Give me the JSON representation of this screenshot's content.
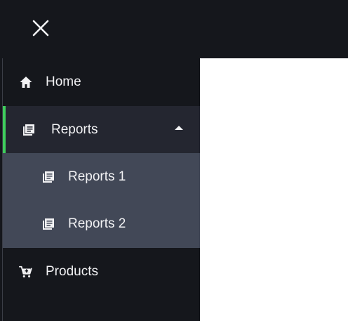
{
  "header": {
    "close_icon": "close-icon"
  },
  "sidebar": {
    "items": [
      {
        "label": "Home",
        "icon": "home-icon"
      },
      {
        "label": "Reports",
        "icon": "reports-icon",
        "expanded": true,
        "accent": "#3fce5c"
      },
      {
        "label": "Products",
        "icon": "cart-plus-icon"
      }
    ],
    "submenu": [
      {
        "label": "Reports 1",
        "icon": "reports-icon"
      },
      {
        "label": "Reports 2",
        "icon": "reports-icon"
      }
    ]
  },
  "colors": {
    "background": "#15171c",
    "active_item": "#242630",
    "submenu": "#424857",
    "accent": "#3fce5c",
    "text": "#f2f2f4",
    "content": "#ffffff"
  }
}
